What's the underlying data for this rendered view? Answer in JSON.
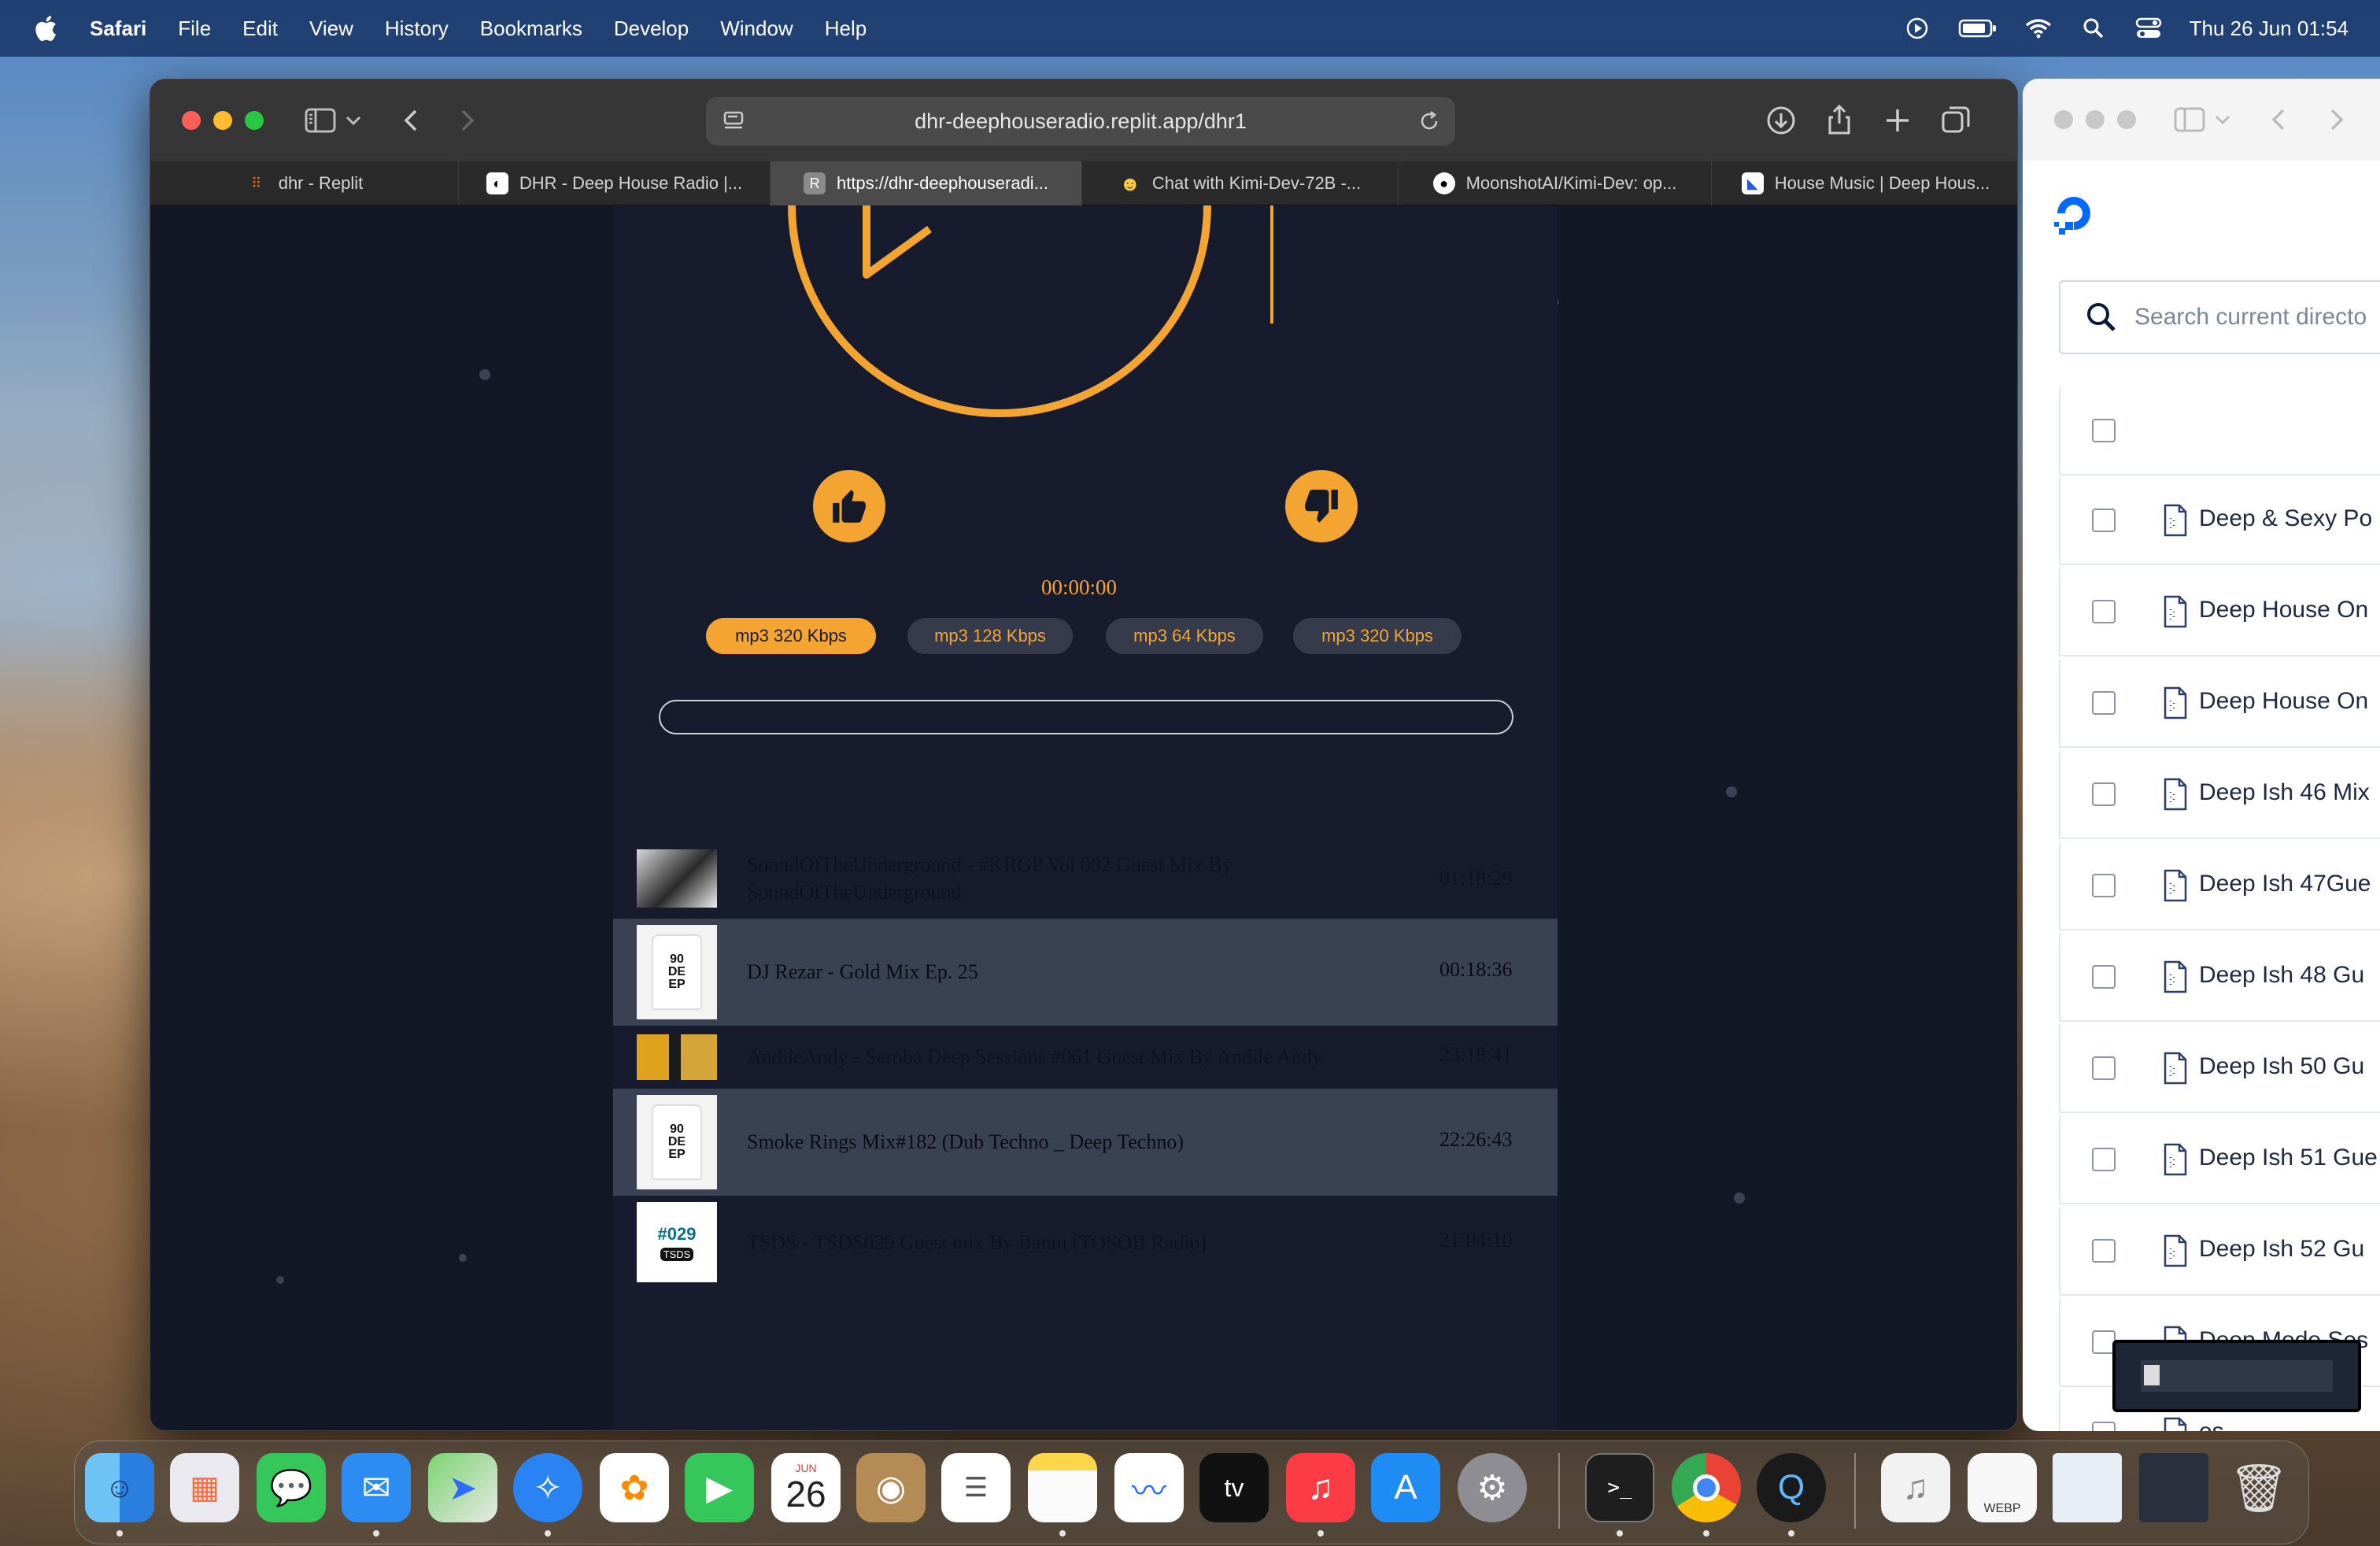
{
  "menubar": {
    "app": "Safari",
    "items": [
      "File",
      "Edit",
      "View",
      "History",
      "Bookmarks",
      "Develop",
      "Window",
      "Help"
    ],
    "clock": "Thu 26 Jun  01:54"
  },
  "browser": {
    "url": "dhr-deephouseradio.replit.app/dhr1",
    "tabs": [
      {
        "label": "dhr - Replit"
      },
      {
        "label": "DHR - Deep House Radio |..."
      },
      {
        "label": "https://dhr-deephouseradi...",
        "active": true
      },
      {
        "label": "Chat with Kimi-Dev-72B -..."
      },
      {
        "label": "MoonshotAI/Kimi-Dev: op..."
      },
      {
        "label": "House Music | Deep Hous..."
      }
    ]
  },
  "player": {
    "timer": "00:00:00",
    "progress": 0,
    "qualities": [
      {
        "label": "mp3 320 Kbps",
        "selected": true
      },
      {
        "label": "mp3 128 Kbps",
        "selected": false
      },
      {
        "label": "mp3 64 Kbps",
        "selected": false
      },
      {
        "label": "mp3 320 Kbps",
        "selected": false
      }
    ],
    "accent": "#f4a531"
  },
  "tracks": [
    {
      "title": "SoundOfTheUnderground - #KRGP Vol 002 Guest Mix By SoundOfTheUnderground",
      "duration": "01:18:29"
    },
    {
      "title": "DJ Rezar - Gold Mix Ep. 25",
      "duration": "00:18:36"
    },
    {
      "title": "AndileAndy - Seroba Deep Sessions #061 Guest Mix By Andile Andy",
      "duration": "23:18:41"
    },
    {
      "title": "Smoke Rings Mix#182 (Dub Techno _ Deep Techno)",
      "duration": "22:26:43"
    },
    {
      "title": "TSDS - TSDS029 Guest mix By Bantu [TOSOB Radio]",
      "duration": "21:04:10"
    }
  ],
  "thumb_text": {
    "shirt": [
      "90",
      "DE",
      "EP"
    ],
    "tsds_number": "#029",
    "tsds_logo": "TSDS"
  },
  "filebrowser": {
    "search_placeholder": "Search current directo",
    "files": [
      "Deep & Sexy Po",
      "Deep House On",
      "Deep House On",
      "Deep Ish 46 Mix",
      "Deep Ish 47Gue",
      "Deep Ish 48 Gu",
      "Deep Ish 50 Gu",
      "Deep Ish 51 Gue",
      "Deep Ish 52 Gu",
      "Deep Mode Ses",
      "es"
    ]
  },
  "dock": {
    "calendar_month": "JUN",
    "calendar_day": "26",
    "tv_label": "tv",
    "webp_label": "WEBP",
    "terminal_prompt": ">_"
  }
}
